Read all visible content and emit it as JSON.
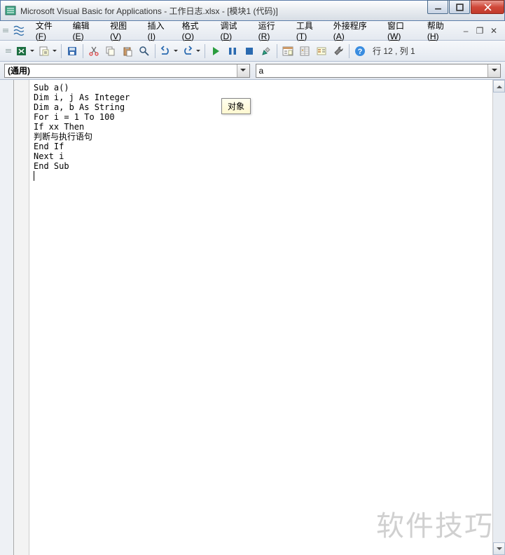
{
  "title": "Microsoft Visual Basic for Applications - 工作日志.xlsx - [模块1 (代码)]",
  "menu": {
    "items": [
      {
        "label": "文件",
        "key": "F"
      },
      {
        "label": "编辑",
        "key": "E"
      },
      {
        "label": "视图",
        "key": "V"
      },
      {
        "label": "插入",
        "key": "I"
      },
      {
        "label": "格式",
        "key": "O"
      },
      {
        "label": "调试",
        "key": "D"
      },
      {
        "label": "运行",
        "key": "R"
      },
      {
        "label": "工具",
        "key": "T"
      },
      {
        "label": "外接程序",
        "key": "A"
      },
      {
        "label": "窗口",
        "key": "W"
      },
      {
        "label": "帮助",
        "key": "H"
      }
    ]
  },
  "toolbar": {
    "icons": [
      "excel-icon",
      "insert-module-icon",
      "sep",
      "save-icon",
      "sep",
      "cut-icon",
      "copy-icon",
      "paste-icon",
      "find-icon",
      "sep",
      "undo-icon",
      "redo-icon",
      "sep",
      "run-icon",
      "break-icon",
      "reset-icon",
      "design-mode-icon",
      "sep",
      "project-explorer-icon",
      "properties-icon",
      "object-browser-icon",
      "toolbox-icon",
      "sep",
      "help-icon"
    ],
    "status": "行 12 , 列 1"
  },
  "dropdowns": {
    "left": "(通用)",
    "right": "a"
  },
  "tooltip": "对象",
  "code": "Sub a()\nDim i, j As Integer\nDim a, b As String\nFor i = 1 To 100\nIf xx Then\n判断与执行语句\nEnd If\nNext i\nEnd Sub",
  "watermark": "软件技巧"
}
